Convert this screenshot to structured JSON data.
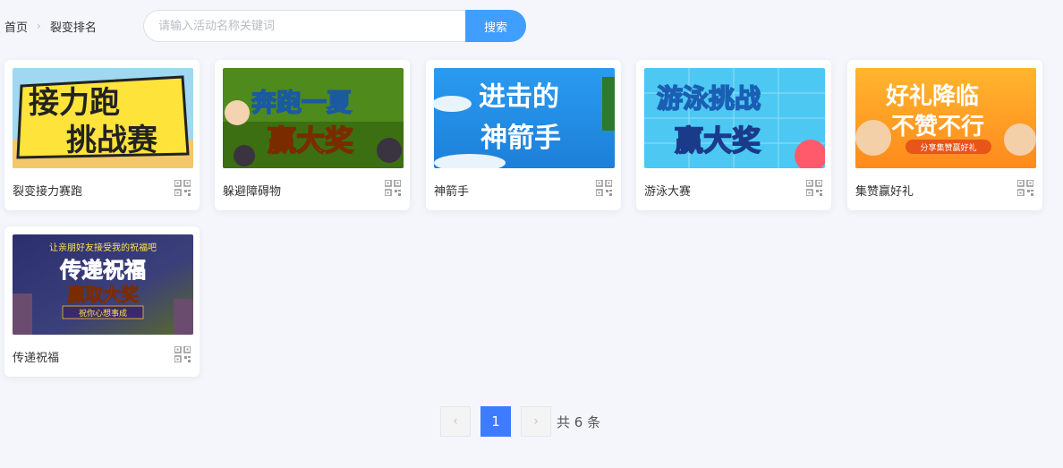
{
  "breadcrumb": {
    "home": "首页",
    "current": "裂变排名"
  },
  "search": {
    "placeholder": "请输入活动名称关键词",
    "button": "搜索"
  },
  "cards": [
    {
      "name": "裂变接力赛跑",
      "banner_line1": "接力跑",
      "banner_line2": "挑战赛"
    },
    {
      "name": "躲避障碍物",
      "banner_line1": "奔跑一夏",
      "banner_line2": "赢大奖"
    },
    {
      "name": "神箭手",
      "banner_line1": "进击的",
      "banner_line2": "神箭手"
    },
    {
      "name": "游泳大赛",
      "banner_line1": "游泳挑战",
      "banner_line2": "赢大奖"
    },
    {
      "name": "集赞赢好礼",
      "banner_line1": "好礼降临",
      "banner_line2": "不赞不行",
      "banner_line3": "分享集赞赢好礼"
    },
    {
      "name": "传递祝福",
      "banner_line0": "让亲朋好友接受我的祝福吧",
      "banner_line1": "传递祝福",
      "banner_line2": "赢取大奖",
      "banner_line3": "祝你心想事成"
    }
  ],
  "pagination": {
    "current": "1",
    "total": "共 6 条",
    "prev_icon": "chevron-left-icon",
    "next_icon": "chevron-right-icon"
  },
  "colors": {
    "accent": "#409eff",
    "page_active": "#3d7bff",
    "background": "#f4f6fb"
  }
}
